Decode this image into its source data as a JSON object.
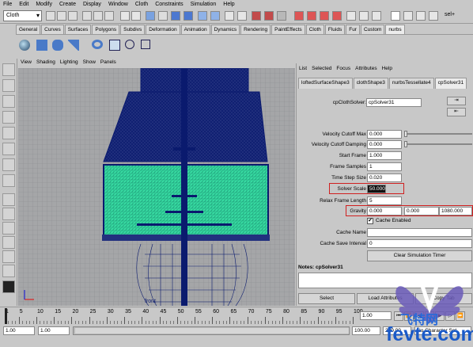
{
  "menubar": [
    "File",
    "Edit",
    "Modify",
    "Create",
    "Display",
    "Window",
    "Cloth",
    "Constraints",
    "Simulation",
    "Help"
  ],
  "toolbar": {
    "menuset": "Cloth",
    "right_label": "sel+"
  },
  "shelf_tabs": [
    "General",
    "Curves",
    "Surfaces",
    "Polygons",
    "Subdivs",
    "Deformation",
    "Animation",
    "Dynamics",
    "Rendering",
    "PaintEffects",
    "Cloth",
    "Fluids",
    "Fur",
    "Custom",
    "nurbs"
  ],
  "shelf_active": 14,
  "viewport": {
    "menu": [
      "View",
      "Shading",
      "Lighting",
      "Show",
      "Panels"
    ],
    "view_label": "front"
  },
  "attribute_editor": {
    "menu": [
      "List",
      "Selected",
      "Focus",
      "Attributes",
      "Help"
    ],
    "tabs": [
      "loftedSurfaceShape3",
      "clothShape3",
      "nurbsTessellate4",
      "cpSolver31"
    ],
    "active_tab": 3,
    "node_label": "cpClothSolver:",
    "node_name": "cpSolver31",
    "attrs": {
      "velocity_cutoff_max": {
        "label": "Velocity Cutoff Max",
        "value": "0.000"
      },
      "velocity_cutoff_damping": {
        "label": "Velocity Cutoff Damping",
        "value": "0.000"
      },
      "start_frame": {
        "label": "Start Frame",
        "value": "1.000"
      },
      "frame_samples": {
        "label": "Frame Samples",
        "value": "1"
      },
      "time_step_size": {
        "label": "Time Step Size",
        "value": "0.020"
      },
      "solver_scale": {
        "label": "Solver Scale",
        "value": "50.000"
      },
      "relax_frame_length": {
        "label": "Relax Frame Length",
        "value": "5"
      },
      "gravity": {
        "label": "Gravity",
        "x": "0.000",
        "y": "0.000",
        "z": "1080.000"
      },
      "cache_enabled": {
        "label": "Cache Enabled",
        "checked": true
      },
      "cache_name": {
        "label": "Cache Name",
        "value": ""
      },
      "cache_save_interval": {
        "label": "Cache Save Interval",
        "value": "0"
      }
    },
    "clear_button": "Clear Simulation Timer",
    "notes_label": "Notes: cpSolver31",
    "buttons": [
      "Select",
      "Load Attributes",
      "Copy Tab"
    ]
  },
  "timeline": {
    "ticks": [
      "1",
      "5",
      "10",
      "15",
      "20",
      "25",
      "30",
      "35",
      "40",
      "45",
      "50",
      "55",
      "60",
      "65",
      "70",
      "75",
      "80",
      "85",
      "90",
      "95",
      "100"
    ],
    "current": "1.00"
  },
  "range": {
    "start": "1.00",
    "inner_start": "1.00",
    "end": "100.00",
    "outer_end": "200.00",
    "character": "No Character Set"
  },
  "watermark": {
    "text": "fevte.com",
    "chinese": "飞特网"
  },
  "colors": {
    "mesh_dark": "#0a1a6e",
    "mesh_cloth": "#36d8a0",
    "highlight": "#d02020",
    "viewport_bg": "#a5a6a8"
  }
}
